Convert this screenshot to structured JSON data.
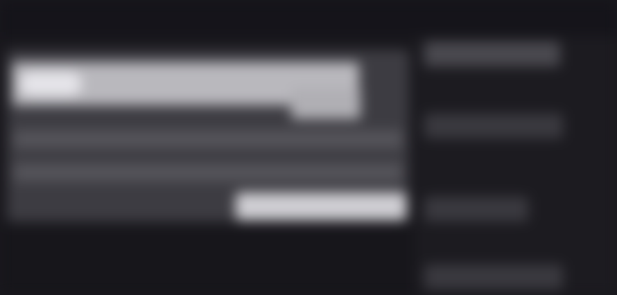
{
  "window": {
    "title": ""
  },
  "panel": {
    "banner_text": "",
    "rows": [
      "",
      ""
    ],
    "action_label": ""
  },
  "sidebar": {
    "items": [
      "",
      "",
      "",
      ""
    ]
  },
  "colors": {
    "background": "#19181d",
    "panel": "#3d3c42",
    "banner": "#b9b8bd",
    "action": "#cfced3",
    "sidebar": "#1c1b20"
  }
}
